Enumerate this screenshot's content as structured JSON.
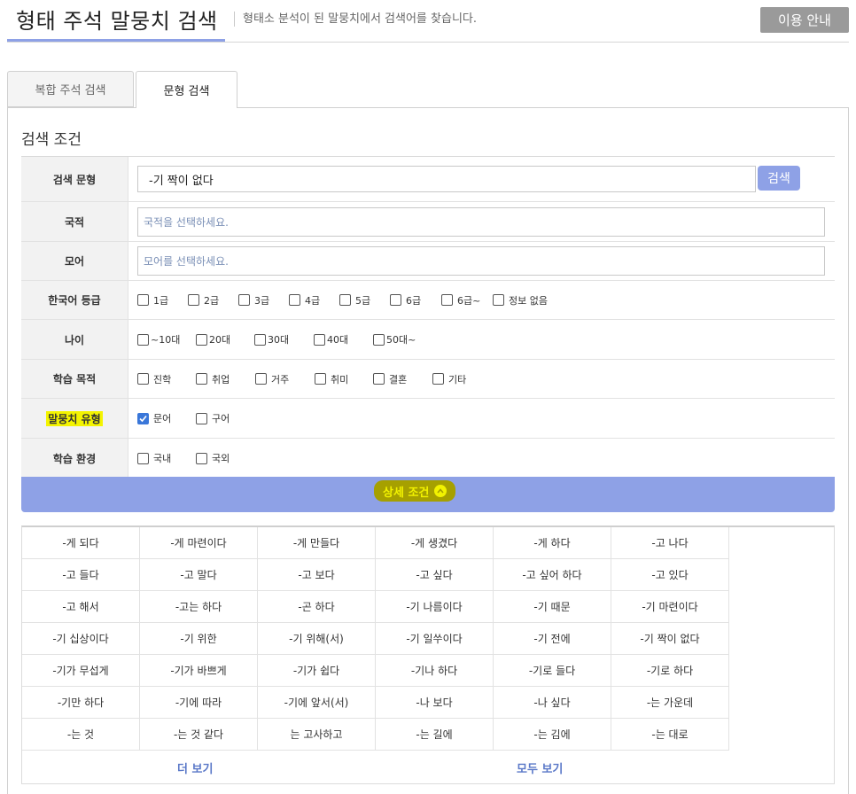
{
  "header": {
    "title": "형태 주석 말뭉치 검색",
    "subtitle": "형태소 분석이 된 말뭉치에서 검색어를 찾습니다.",
    "help_label": "이용 안내"
  },
  "tabs": [
    {
      "label": "복합 주석 검색",
      "active": false
    },
    {
      "label": "문형 검색",
      "active": true
    }
  ],
  "section_title": "검색 조건",
  "form": {
    "pattern": {
      "label": "검색 문형",
      "value": "-기 짝이 없다",
      "button": "검색"
    },
    "nationality": {
      "label": "국적",
      "placeholder": "국적을 선택하세요."
    },
    "mother_tongue": {
      "label": "모어",
      "placeholder": "모어를 선택하세요."
    },
    "level": {
      "label": "한국어 등급",
      "options": [
        "1급",
        "2급",
        "3급",
        "4급",
        "5급",
        "6급",
        "6급~",
        "정보 없음"
      ]
    },
    "age": {
      "label": "나이",
      "options": [
        "~10대",
        "20대",
        "30대",
        "40대",
        "50대~"
      ]
    },
    "purpose": {
      "label": "학습 목적",
      "options": [
        "진학",
        "취업",
        "거주",
        "취미",
        "결혼",
        "기타"
      ]
    },
    "corpus_type": {
      "label": "말뭉치 유형",
      "options": [
        "문어",
        "구어"
      ],
      "checked": [
        "문어"
      ]
    },
    "environment": {
      "label": "학습 환경",
      "options": [
        "국내",
        "국외"
      ]
    }
  },
  "detail_label": "상세 조건",
  "colors": {
    "accent": "#8ea1e6",
    "highlight": "#f4f400",
    "checkbox": "#3a77d9"
  },
  "results": [
    "-게 되다",
    "-게 마련이다",
    "-게 만들다",
    "-게 생겼다",
    "-게 하다",
    "-고 나다",
    "-고 들다",
    "-고 말다",
    "-고 보다",
    "-고 싶다",
    "-고 싶어 하다",
    "-고 있다",
    "-고 해서",
    "-고는 하다",
    "-곤 하다",
    "-기 나름이다",
    "-기 때문",
    "-기 마련이다",
    "-기 십상이다",
    "-기 위한",
    "-기 위해(서)",
    "-기 일쑤이다",
    "-기 전에",
    "-기 짝이 없다",
    "-기가 무섭게",
    "-기가 바쁘게",
    "-기가 쉽다",
    "-기나 하다",
    "-기로 들다",
    "-기로 하다",
    "-기만 하다",
    "-기에 따라",
    "-기에 앞서(서)",
    "-나 보다",
    "-나 싶다",
    "-는 가운데",
    "-는 것",
    "-는 것 같다",
    "는 고사하고",
    "-는 길에",
    "-는 김에",
    "-는 대로"
  ],
  "footer": {
    "more": "더 보기",
    "all": "모두 보기"
  }
}
